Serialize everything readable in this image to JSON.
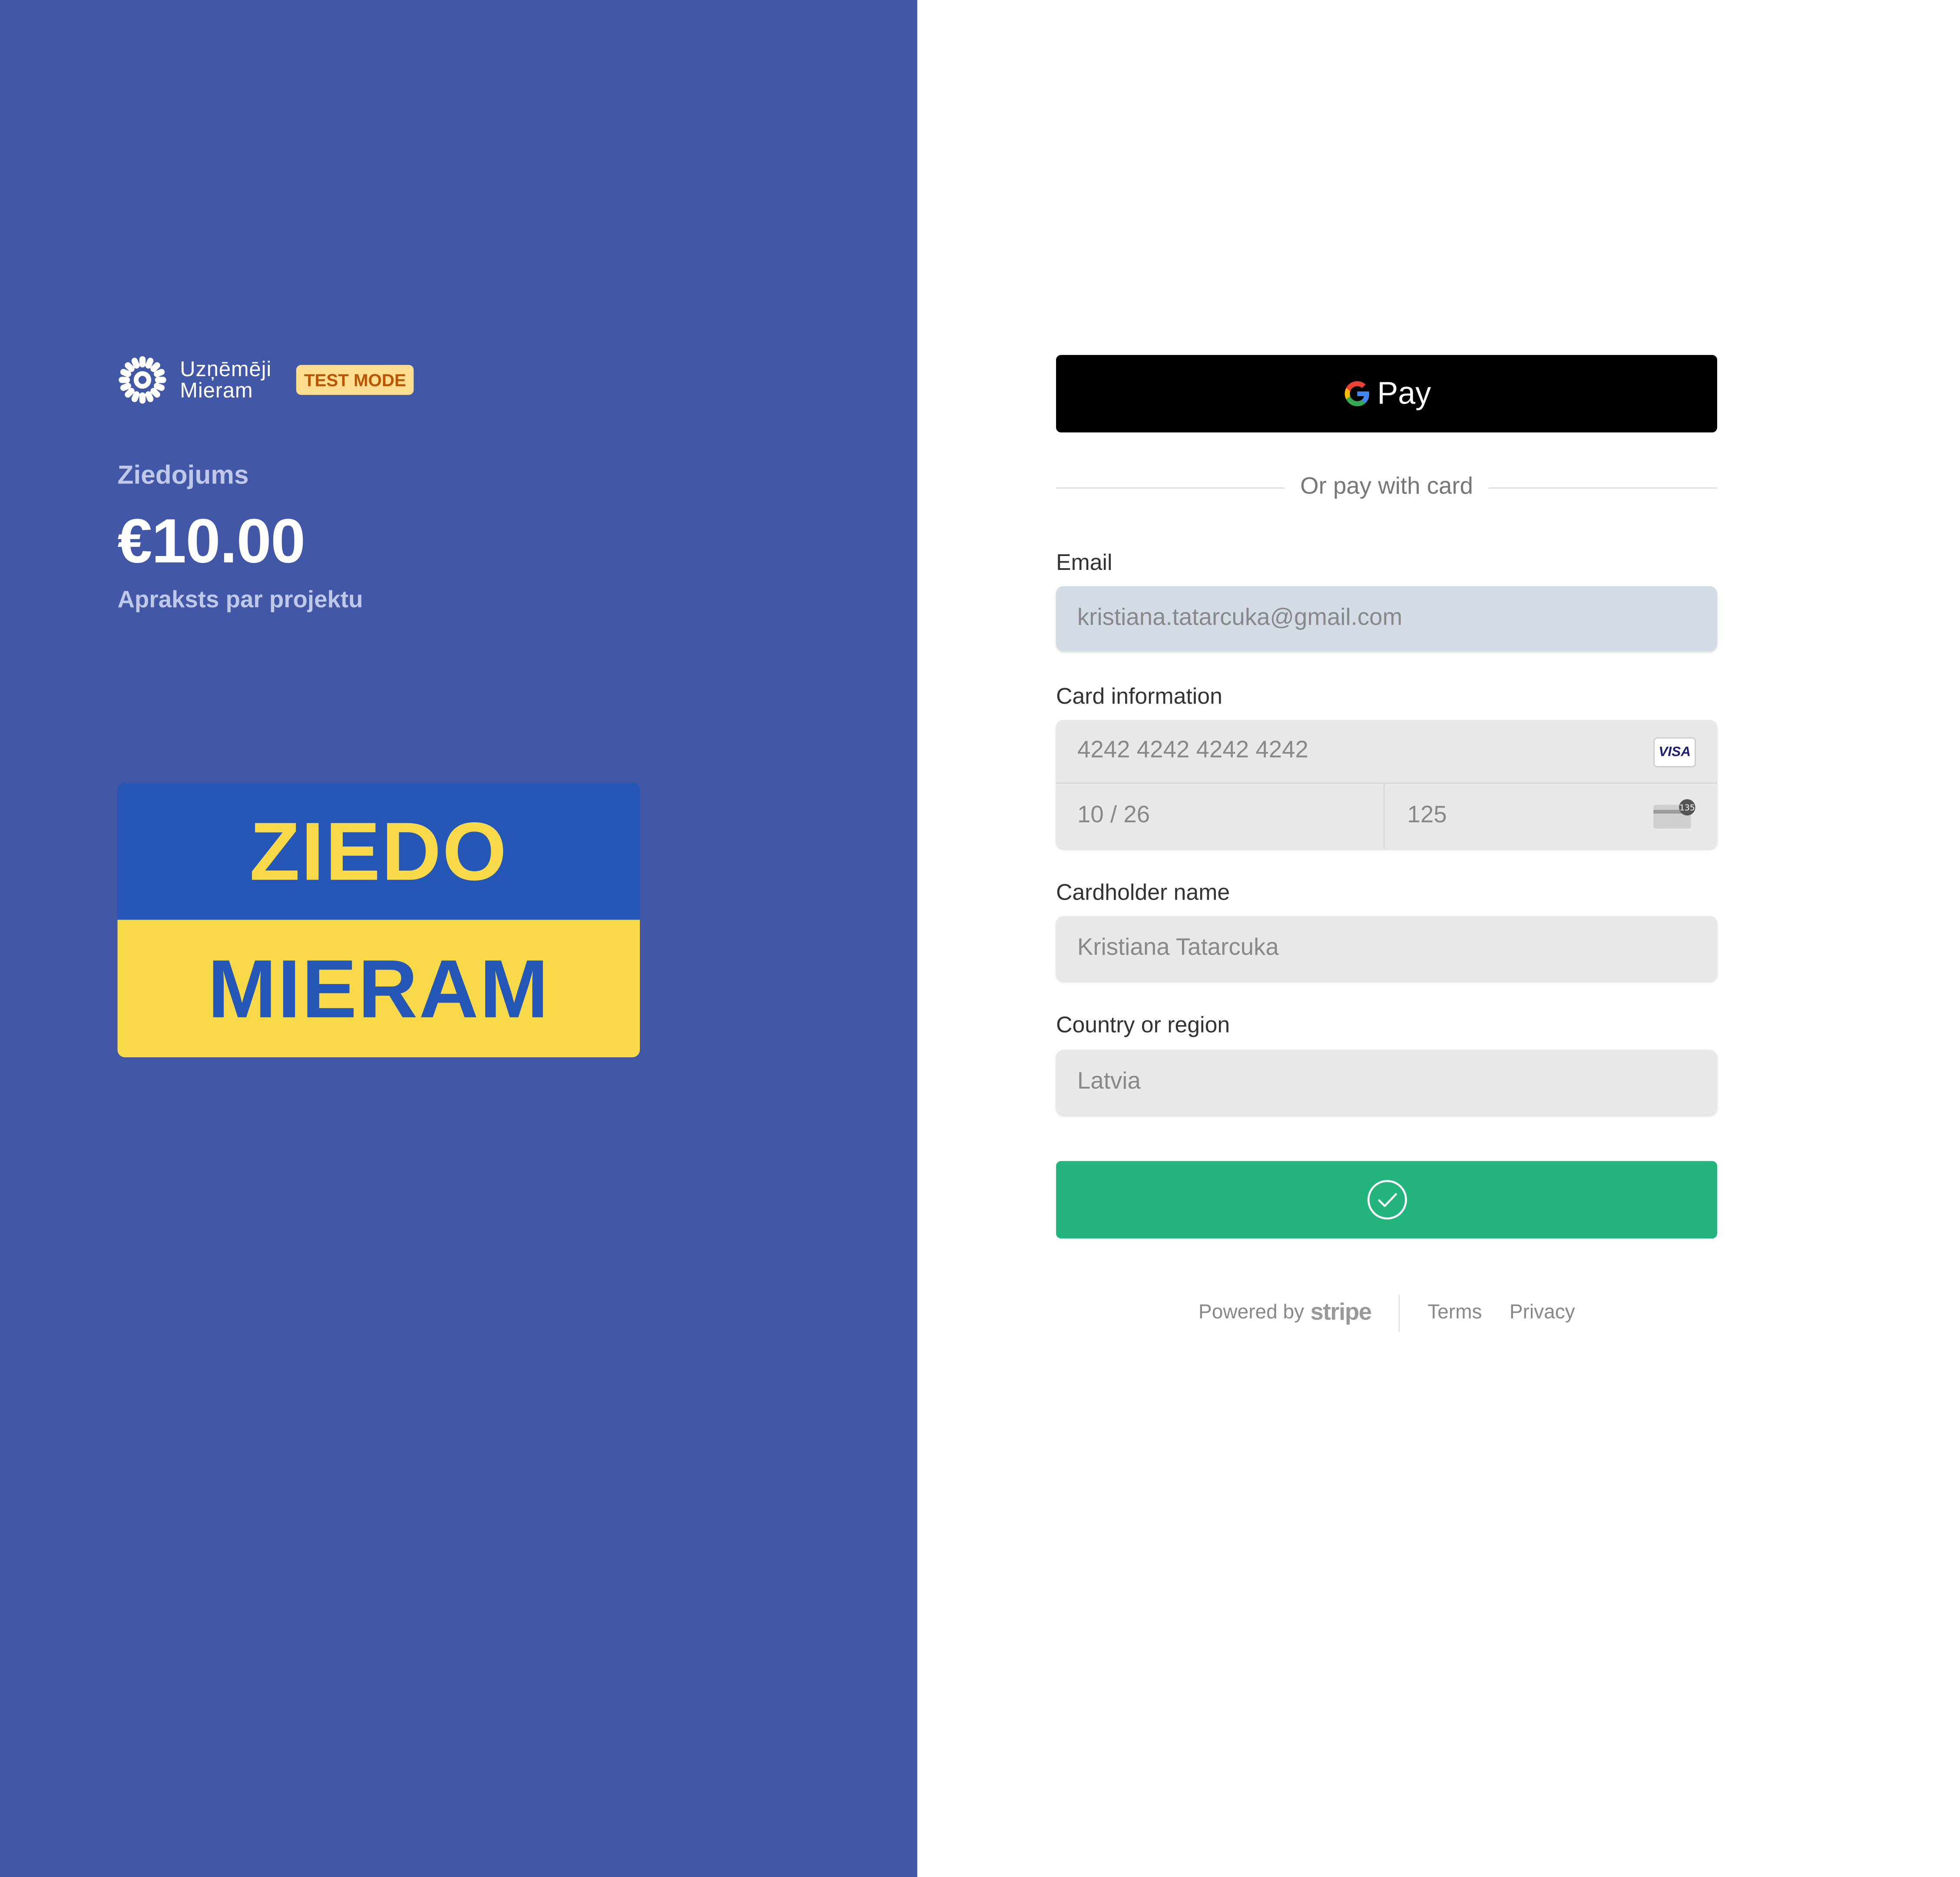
{
  "merchant": {
    "name_line1": "Uzņēmēji",
    "name_line2": "Mieram",
    "logo_icon": "sun-flower-logo-icon",
    "test_badge": "TEST MODE"
  },
  "product": {
    "name": "Ziedojums",
    "price": "€10.00",
    "description": "Apraksts par projektu",
    "image_top_text": "ZIEDO",
    "image_bottom_text": "MIERAM",
    "image_colors": {
      "blue": "#2557b7",
      "yellow": "#f8d94a"
    }
  },
  "payment": {
    "wallet_button_label": "Pay",
    "wallet_icon": "google-g-icon",
    "divider_text": "Or pay with card",
    "email": {
      "label": "Email",
      "value": "kristiana.tatarcuka@gmail.com"
    },
    "card": {
      "label": "Card information",
      "number": "4242 4242 4242 4242",
      "brand_badge": "VISA",
      "expiry": "10 / 26",
      "cvc": "125",
      "cvc_icon_text": "135"
    },
    "cardholder": {
      "label": "Cardholder name",
      "value": "Kristiana Tatarcuka"
    },
    "country": {
      "label": "Country or region",
      "value": "Latvia"
    },
    "submit_icon": "checkmark-circle-icon",
    "submit_color": "#24b47e"
  },
  "footer": {
    "powered_by": "Powered by",
    "stripe": "stripe",
    "terms": "Terms",
    "privacy": "Privacy"
  },
  "colors": {
    "left_panel": "#4257a6",
    "badge_bg": "#ffde92",
    "badge_text": "#bb5504"
  }
}
